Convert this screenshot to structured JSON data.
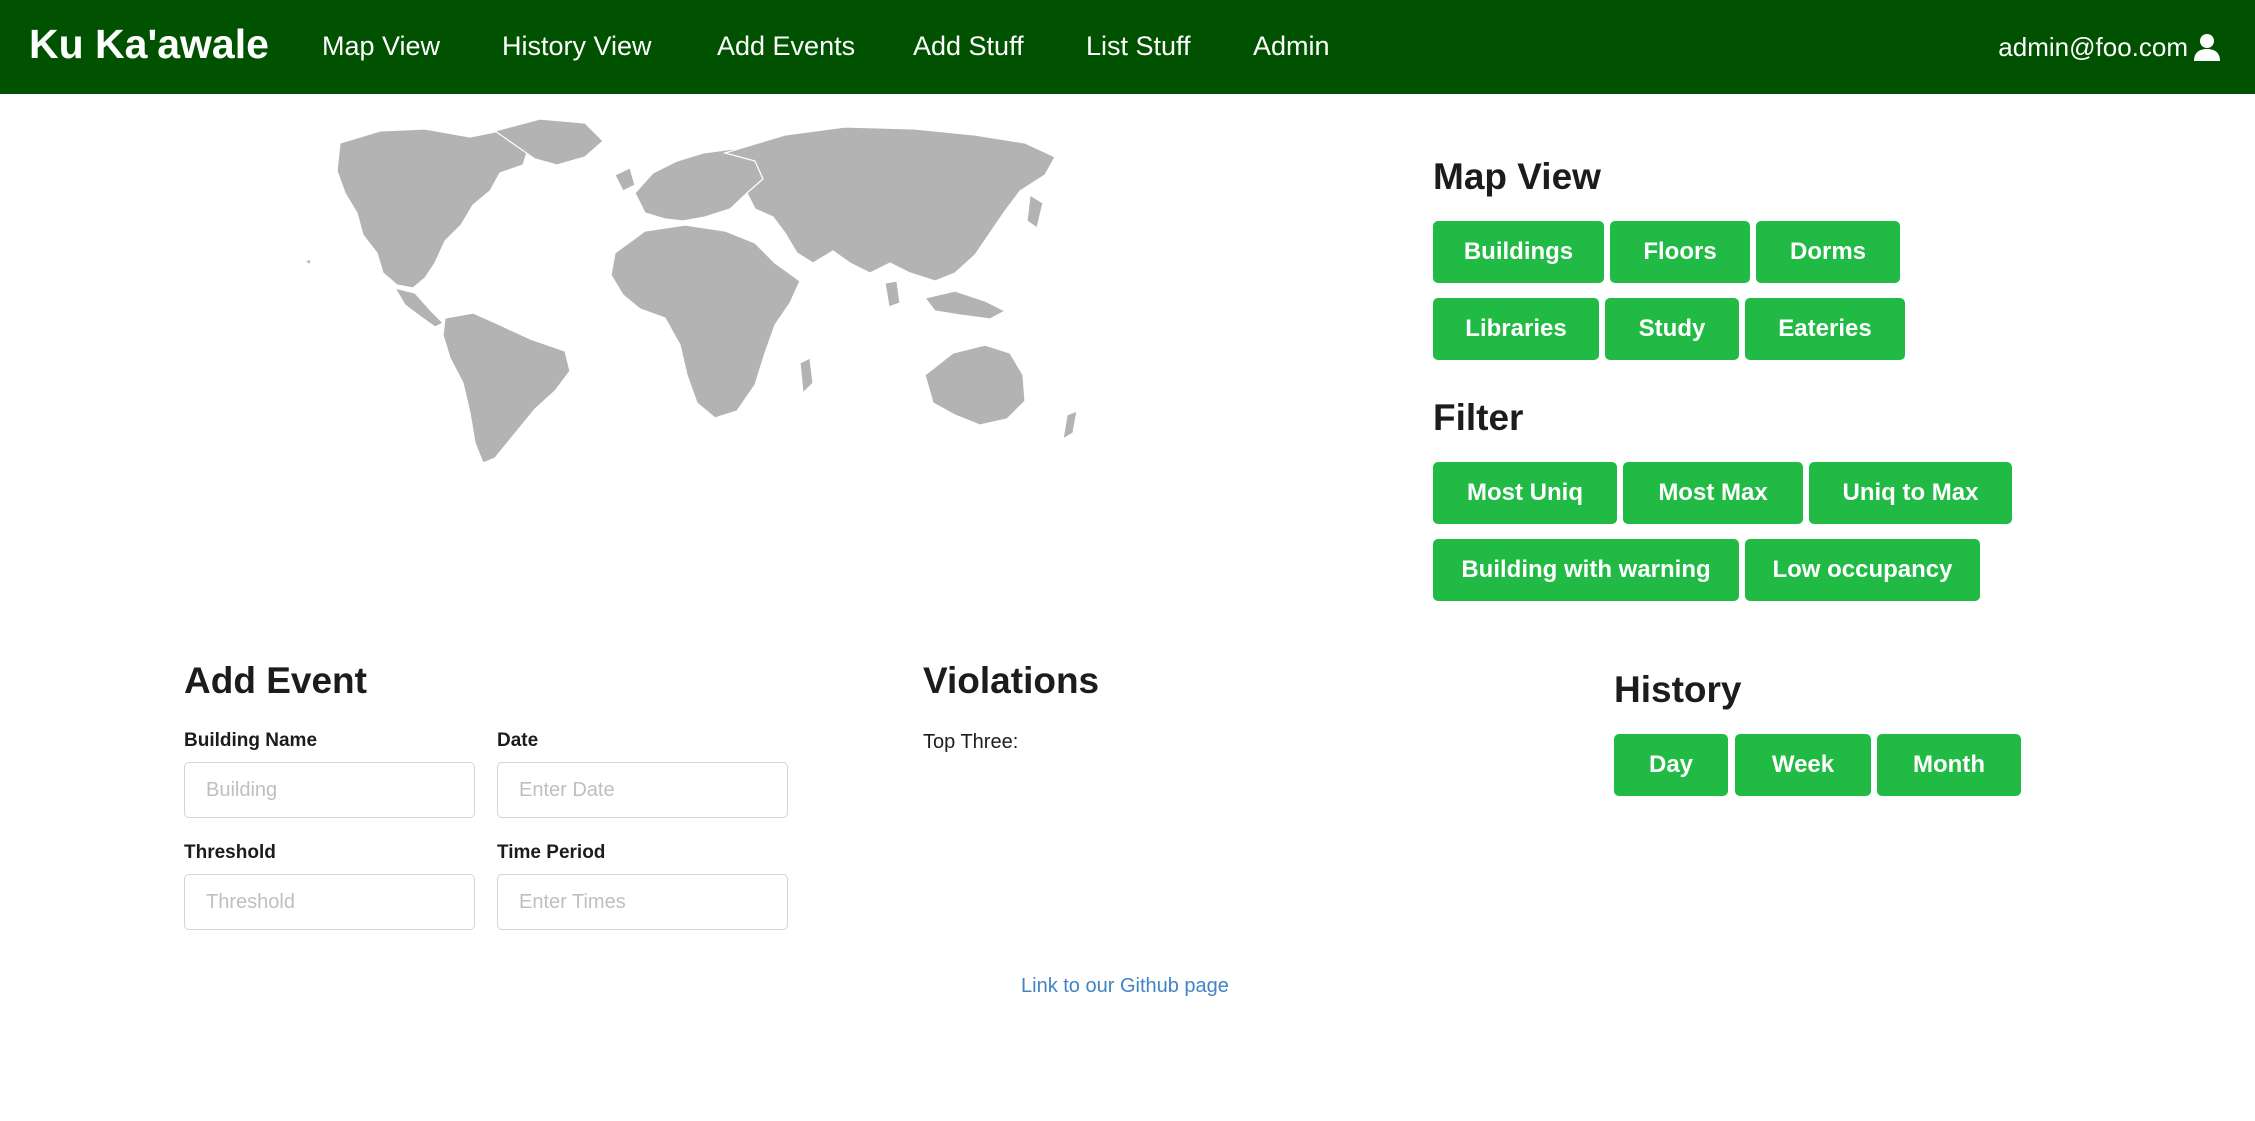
{
  "navbar": {
    "brand": "Ku Ka'awale",
    "items": [
      {
        "label": "Map View"
      },
      {
        "label": "History View"
      },
      {
        "label": "Add Events"
      },
      {
        "label": "Add Stuff"
      },
      {
        "label": "List Stuff"
      },
      {
        "label": "Admin"
      }
    ],
    "user_email": "admin@foo.com"
  },
  "map_view": {
    "title": "Map View",
    "buttons": [
      "Buildings",
      "Floors",
      "Dorms",
      "Libraries",
      "Study",
      "Eateries"
    ]
  },
  "filter": {
    "title": "Filter",
    "buttons": [
      "Most Uniq",
      "Most Max",
      "Uniq to Max",
      "Building with warning",
      "Low occupancy"
    ]
  },
  "add_event": {
    "title": "Add Event",
    "fields": [
      {
        "label": "Building Name",
        "placeholder": "Building"
      },
      {
        "label": "Date",
        "placeholder": "Enter Date"
      },
      {
        "label": "Threshold",
        "placeholder": "Threshold"
      },
      {
        "label": "Time Period",
        "placeholder": "Enter Times"
      }
    ]
  },
  "violations": {
    "title": "Violations",
    "subtitle": "Top Three:"
  },
  "history": {
    "title": "History",
    "buttons": [
      "Day",
      "Week",
      "Month"
    ]
  },
  "footer": {
    "link_text": "Link to our Github page"
  },
  "colors": {
    "navbar_bg": "#005200",
    "button_green": "#21ba45",
    "link_blue": "#4183c4",
    "map_land": "#b3b3b3"
  },
  "icons": {
    "user": "user-icon"
  }
}
